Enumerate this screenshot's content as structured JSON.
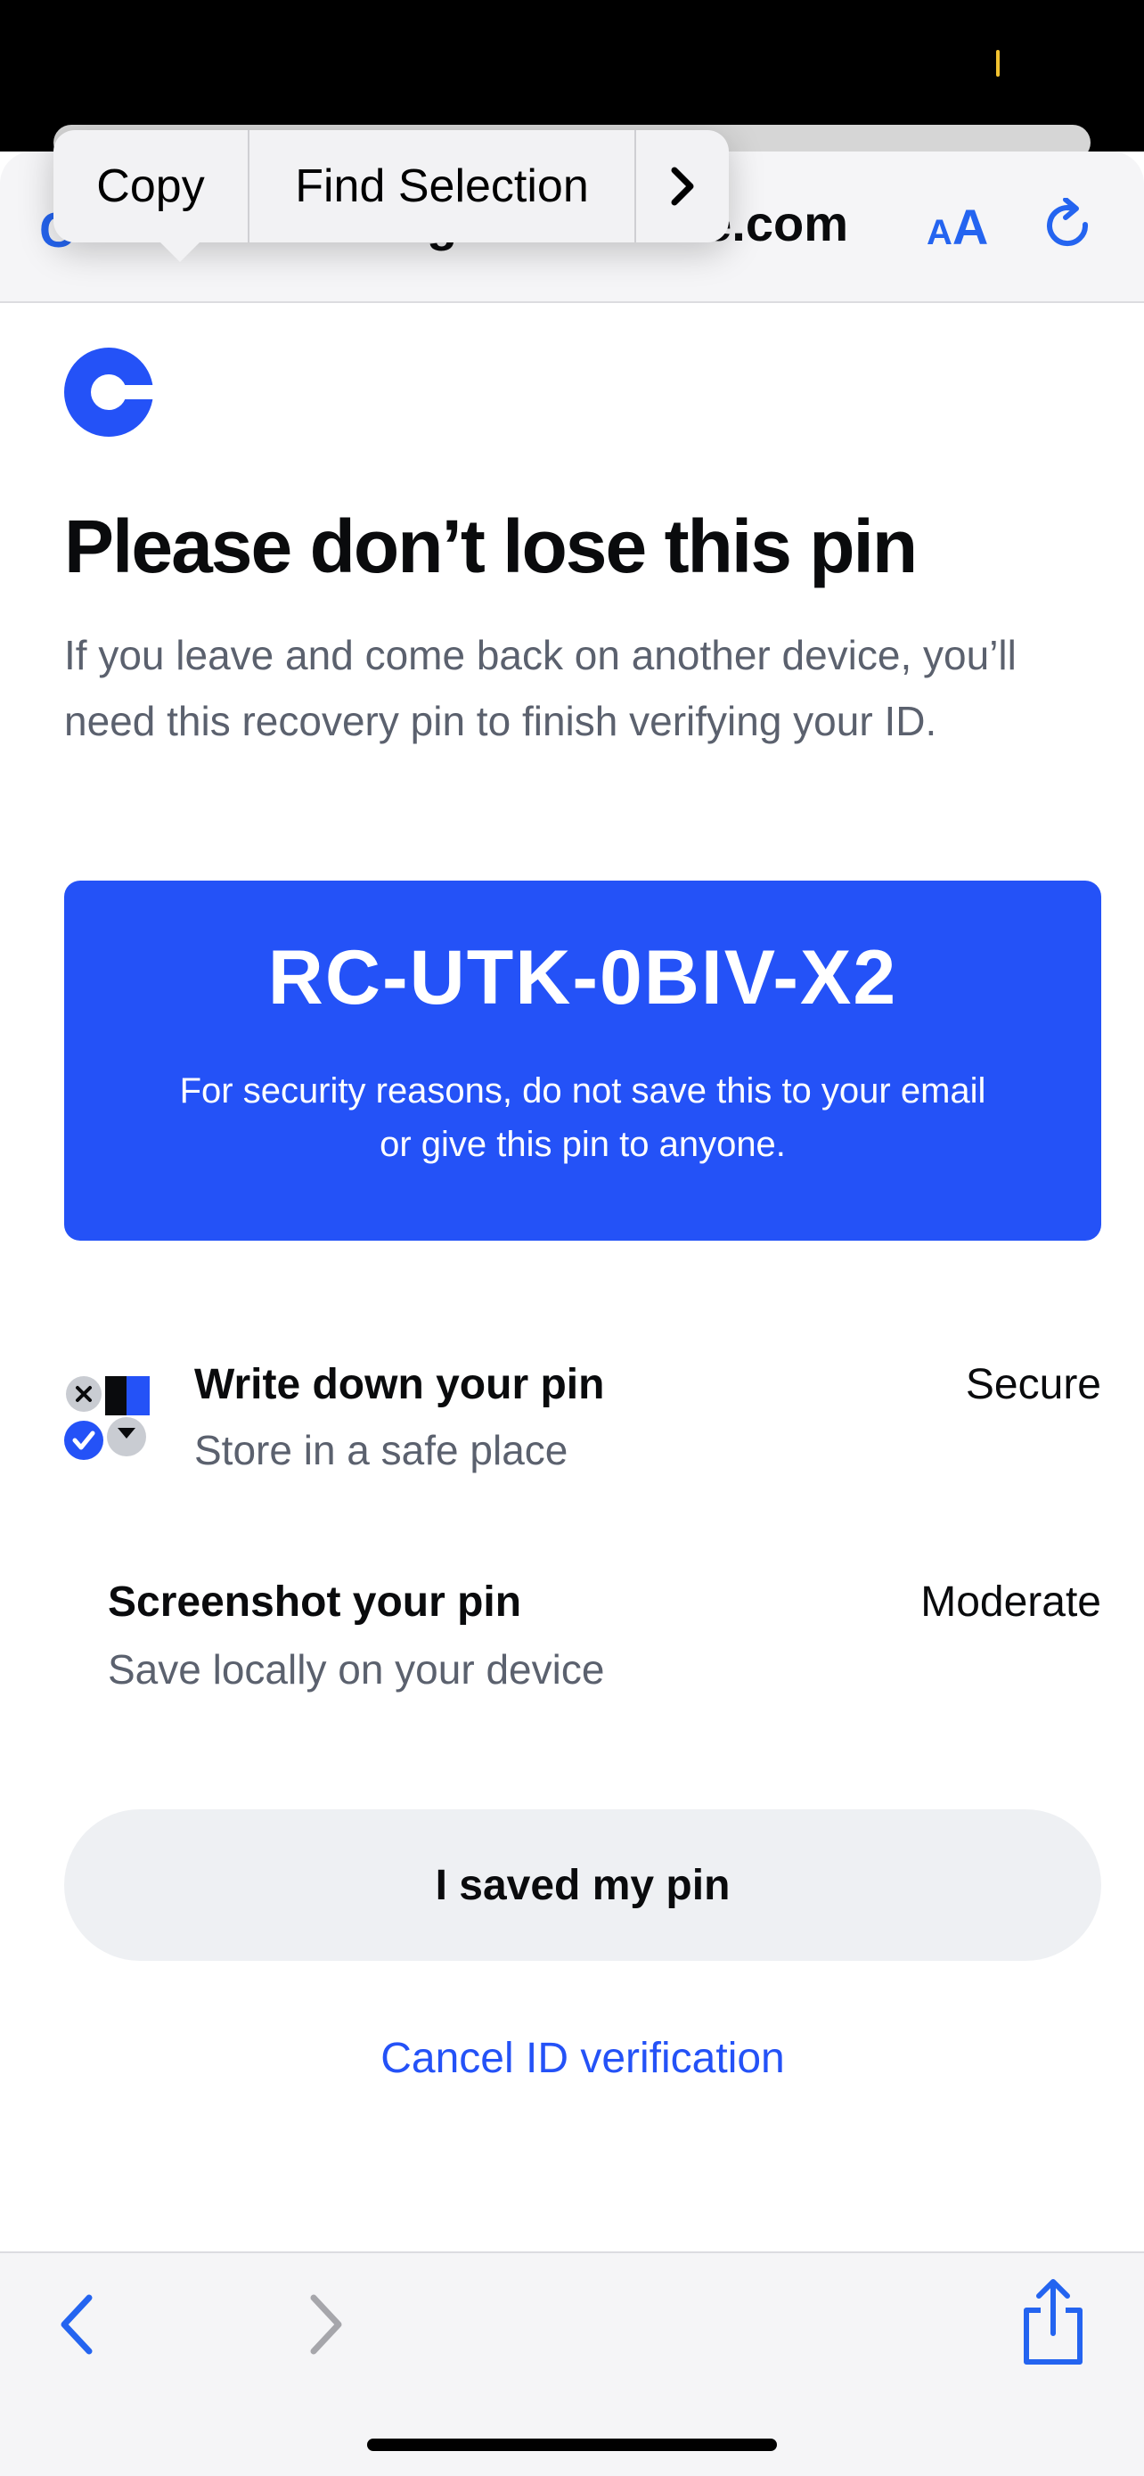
{
  "browser": {
    "url_left_fragment": "C",
    "url_text": "login.coinbase.com",
    "reader_button": "AA",
    "reader_button_small": "A",
    "reader_button_large": "A"
  },
  "context_menu": {
    "copy": "Copy",
    "find_selection": "Find Selection",
    "more": "›"
  },
  "page": {
    "title": "Please don’t lose this pin",
    "subtitle": "If you leave and come back on another device, you’ll need this recovery pin to finish verifying your ID."
  },
  "pin_card": {
    "code": "RC-UTK-0BIV-X2",
    "note": "For security reasons, do not save this to your email or give this pin to anyone."
  },
  "options": [
    {
      "title": "Write down your pin",
      "subtitle": "Store in a safe place",
      "tag": "Secure",
      "icon": "write-down-icon"
    },
    {
      "title": "Screenshot your pin",
      "subtitle": "Save locally on your device",
      "tag": "Moderate"
    }
  ],
  "actions": {
    "saved_button": "I saved my pin",
    "cancel_link": "Cancel ID verification"
  },
  "colors": {
    "brand_blue": "#2452F7",
    "ios_blue": "#2464F0",
    "muted_text": "#5B616E",
    "button_bg": "#EEF0F3"
  }
}
